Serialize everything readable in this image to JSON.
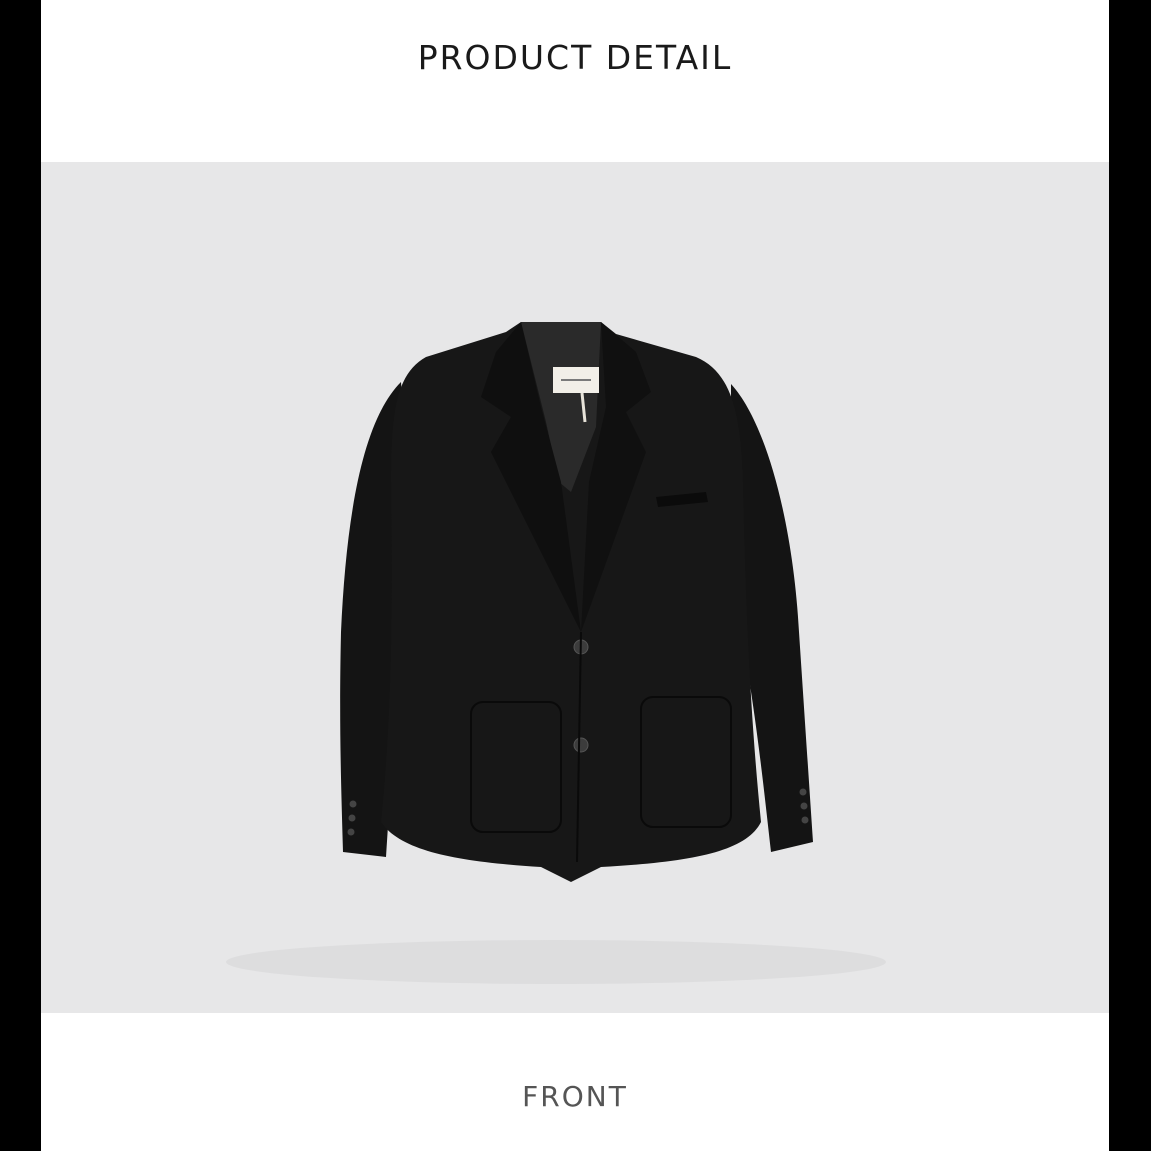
{
  "header": {
    "title": "PRODUCT DETAIL"
  },
  "product_image": {
    "subject": "black blazer jacket",
    "background_color": "#e7e7e8",
    "garment_color": "#161616"
  },
  "caption": {
    "label": "FRONT"
  }
}
